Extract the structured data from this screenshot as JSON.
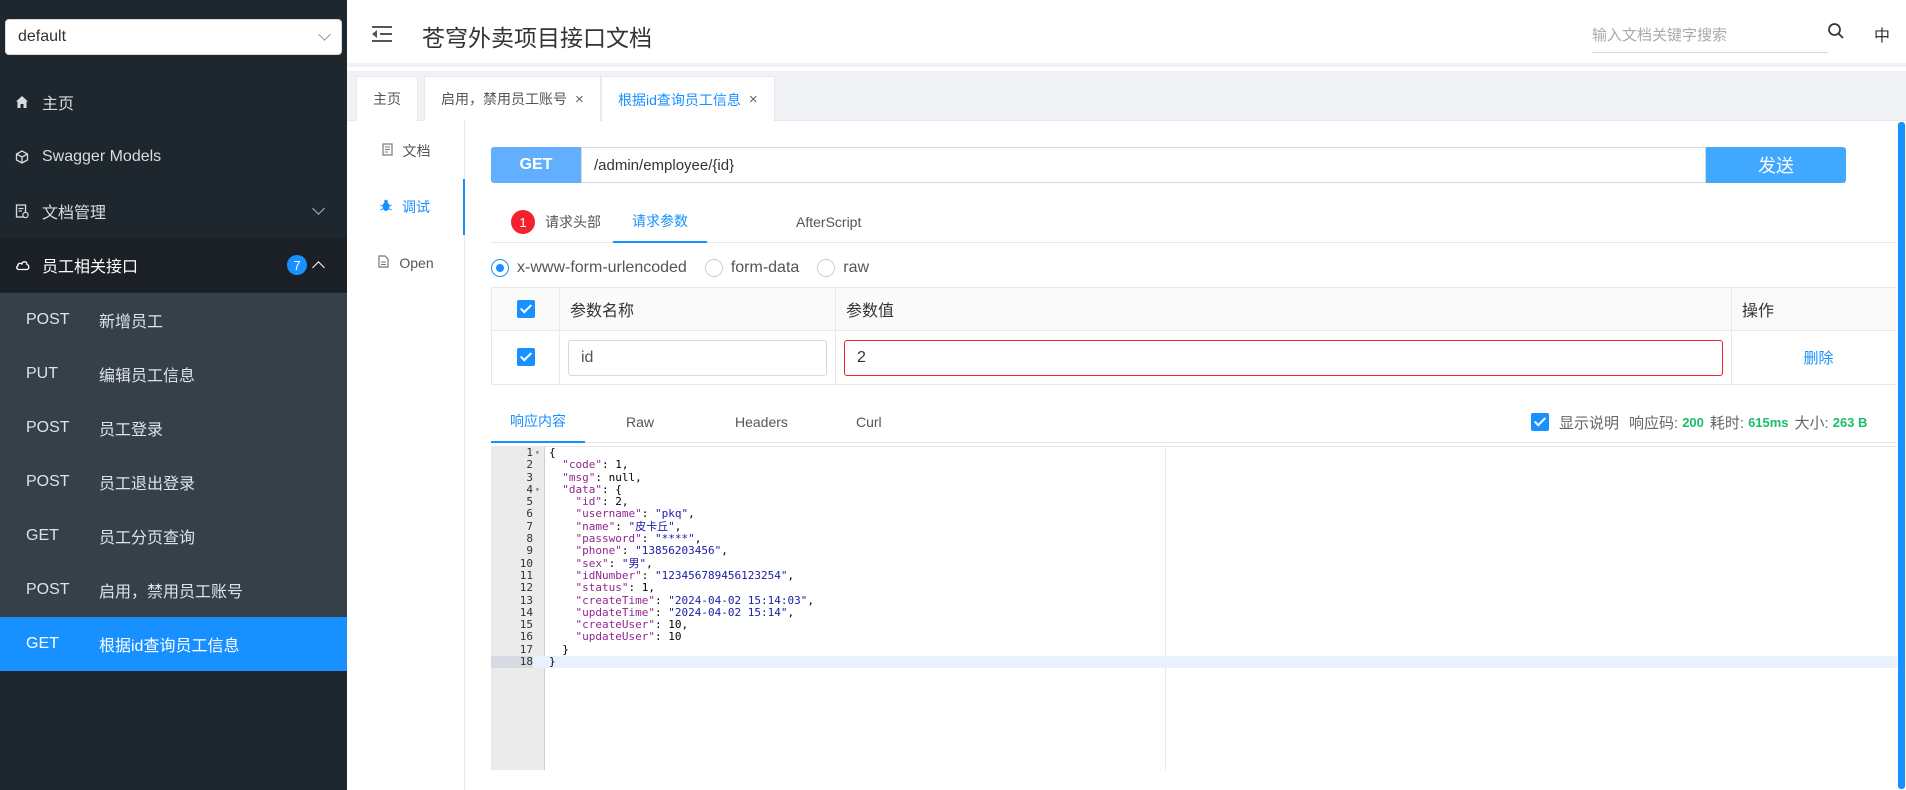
{
  "sidebar": {
    "group_select": "default",
    "items": [
      {
        "label": "主页",
        "icon": "home-icon"
      },
      {
        "label": "Swagger Models",
        "icon": "cube-icon"
      },
      {
        "label": "文档管理",
        "icon": "doc-manage-icon"
      },
      {
        "label": "员工相关接口",
        "icon": "cloud-icon",
        "badge": "7"
      }
    ],
    "apis": [
      {
        "method": "POST",
        "label": "新增员工"
      },
      {
        "method": "PUT",
        "label": "编辑员工信息"
      },
      {
        "method": "POST",
        "label": "员工登录"
      },
      {
        "method": "POST",
        "label": "员工退出登录"
      },
      {
        "method": "GET",
        "label": "员工分页查询"
      },
      {
        "method": "POST",
        "label": "启用，禁用员工账号"
      },
      {
        "method": "GET",
        "label": "根据id查询员工信息"
      }
    ]
  },
  "header": {
    "title": "苍穹外卖项目接口文档",
    "search_placeholder": "输入文档关键字搜索",
    "lang": "中"
  },
  "tabs": [
    {
      "label": "主页"
    },
    {
      "label": "启用，禁用员工账号",
      "close": "×"
    },
    {
      "label": "根据id查询员工信息",
      "close": "×"
    }
  ],
  "doc_menu": [
    {
      "label": "文档"
    },
    {
      "label": "调试"
    },
    {
      "label": "Open"
    }
  ],
  "request": {
    "method": "GET",
    "url": "/admin/employee/{id}",
    "send_label": "发送",
    "tabs": {
      "headers": "请求头部",
      "headers_count": "1",
      "params": "请求参数",
      "afterscript": "AfterScript"
    },
    "body_types": [
      "x-www-form-urlencoded",
      "form-data",
      "raw"
    ],
    "table": {
      "headers": {
        "name": "参数名称",
        "value": "参数值",
        "action": "操作"
      },
      "row": {
        "name": "id",
        "value": "2",
        "action": "删除"
      }
    }
  },
  "response": {
    "tabs": [
      "响应内容",
      "Raw",
      "Headers",
      "Curl"
    ],
    "show_desc": "显示说明",
    "code_label": "响应码:",
    "code": "200",
    "time_label": "耗时:",
    "time": "615ms",
    "size_label": "大小:",
    "size": "263 B",
    "lines": [
      "{",
      "  \"code\": 1,",
      "  \"msg\": null,",
      "  \"data\": {",
      "    \"id\": 2,",
      "    \"username\": \"pkq\",",
      "    \"name\": \"皮卡丘\",",
      "    \"password\": \"****\",",
      "    \"phone\": \"13856203456\",",
      "    \"sex\": \"男\",",
      "    \"idNumber\": \"123456789456123254\",",
      "    \"status\": 1,",
      "    \"createTime\": \"2024-04-02 15:14:03\",",
      "    \"updateTime\": \"2024-04-02 15:14\",",
      "    \"createUser\": 10,",
      "    \"updateUser\": 10",
      "  }",
      "}"
    ]
  }
}
